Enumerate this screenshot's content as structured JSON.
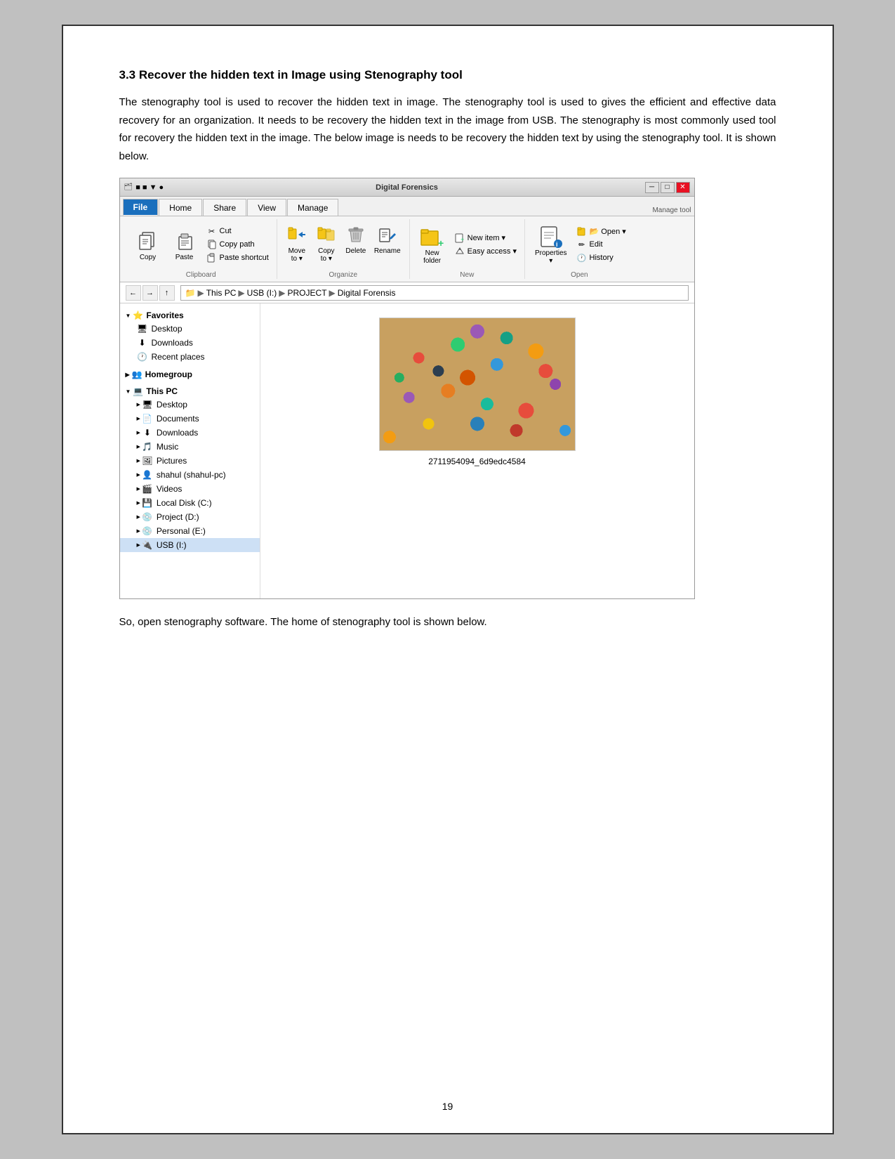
{
  "page": {
    "border_color": "#333",
    "page_number": "19"
  },
  "section": {
    "heading": "3.3   Recover the hidden text in Image using Stenography tool",
    "paragraph": "The stenography tool is used to recover the hidden text in image. The stenography tool is used to gives the efficient and effective data recovery for an organization. It needs to be recovery the hidden text in the image from USB. The stenography is most commonly used tool for recovery the hidden text in the image. The below image is needs to be recovery the hidden text by using the stenography tool. It is shown below.",
    "closing_text": "So, open stenography software. The home of stenography tool is shown below."
  },
  "explorer": {
    "title_bar": {
      "title": "Digital Forensics",
      "left_items": [
        "minimize",
        "maximize",
        "close"
      ],
      "window_controls": [
        "─",
        "□",
        "✕"
      ]
    },
    "ribbon": {
      "tabs": [
        "File",
        "Home",
        "Share",
        "View",
        "Manage"
      ],
      "active_tab": "Home",
      "manage_tab_label": "Manage tool",
      "groups": {
        "clipboard": {
          "label": "Clipboard",
          "big_btns": [
            "Copy",
            "Paste"
          ],
          "small_btns": [
            "Cut",
            "Copy path",
            "Paste shortcut"
          ]
        },
        "organize": {
          "label": "Organize",
          "btns": [
            "Move to",
            "Copy to",
            "Delete",
            "Rename"
          ]
        },
        "new": {
          "label": "New",
          "btns": [
            "New folder"
          ],
          "small_btns": [
            "New item",
            "Easy access"
          ]
        },
        "open": {
          "label": "Open",
          "btns": [
            "Properties"
          ],
          "small_btns": [
            "Open",
            "Edit",
            "History"
          ]
        }
      }
    },
    "address_bar": {
      "path_parts": [
        "This PC",
        "USB (I:)",
        "PROJECT",
        "Digital Forensis"
      ]
    },
    "sidebar": {
      "favorites": {
        "header": "Favorites",
        "items": [
          "Desktop",
          "Downloads",
          "Recent places"
        ]
      },
      "homegroup": {
        "header": "Homegroup"
      },
      "this_pc": {
        "header": "This PC",
        "items": [
          "Desktop",
          "Documents",
          "Downloads",
          "Music",
          "Pictures",
          "shahul (shahul-pc)",
          "Videos",
          "Local Disk (C:)",
          "Project (D:)",
          "Personal (E:)",
          "USB (I:)"
        ]
      }
    },
    "file_area": {
      "image_caption": "2711954094_6d9edc4584"
    }
  }
}
